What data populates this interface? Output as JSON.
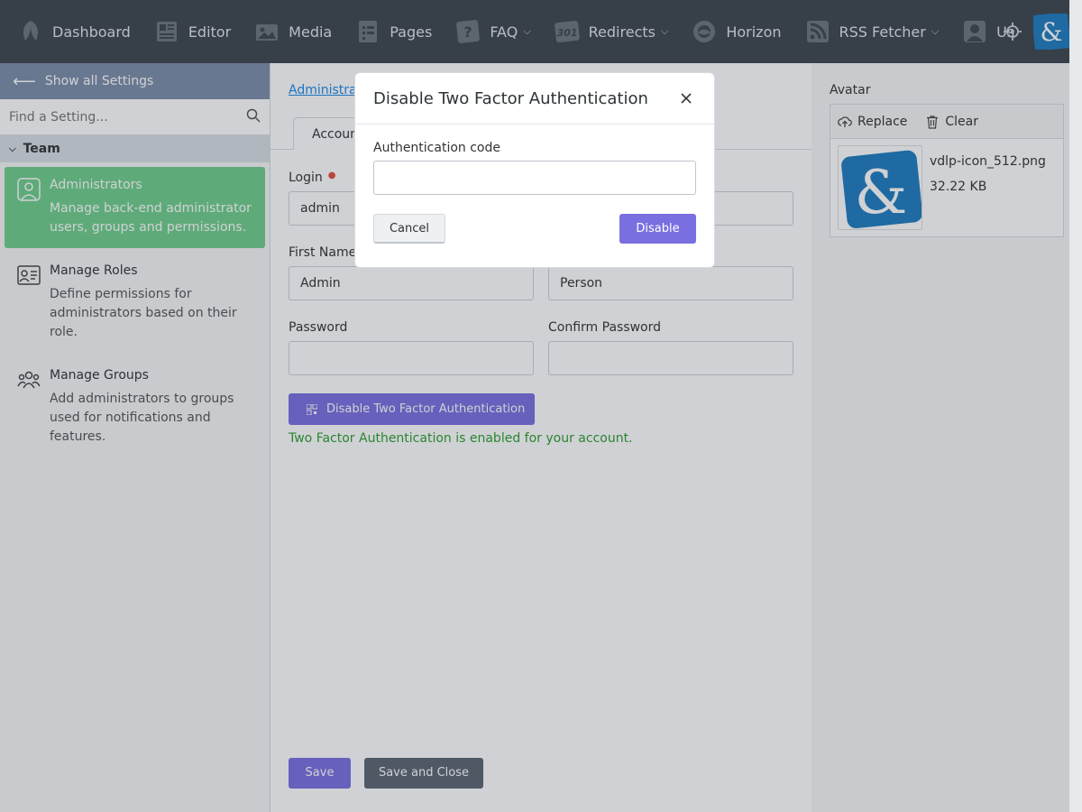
{
  "nav": {
    "items": [
      {
        "label": "Dashboard",
        "icon": "leaf-icon",
        "dropdown": false
      },
      {
        "label": "Editor",
        "icon": "editor-icon",
        "dropdown": false
      },
      {
        "label": "Media",
        "icon": "media-icon",
        "dropdown": false
      },
      {
        "label": "Pages",
        "icon": "pages-icon",
        "dropdown": false
      },
      {
        "label": "FAQ",
        "icon": "question-icon",
        "dropdown": true
      },
      {
        "label": "Redirects",
        "icon": "redirect-301-icon",
        "dropdown": true
      },
      {
        "label": "Horizon",
        "icon": "horizon-icon",
        "dropdown": false
      },
      {
        "label": "RSS Fetcher",
        "icon": "rss-icon",
        "dropdown": true
      },
      {
        "label": "Us",
        "icon": "user-icon",
        "dropdown": false
      }
    ],
    "redirect_badge": "301",
    "question_badge": "?"
  },
  "sidebar": {
    "show_all": "Show all Settings",
    "search_placeholder": "Find a Setting...",
    "group": "Team",
    "items": [
      {
        "title": "Administrators",
        "desc": "Manage back-end administrator users, groups and permissions.",
        "active": true
      },
      {
        "title": "Manage Roles",
        "desc": "Define permissions for administrators based on their role.",
        "active": false
      },
      {
        "title": "Manage Groups",
        "desc": "Add administrators to groups used for notifications and features.",
        "active": false
      }
    ]
  },
  "main": {
    "breadcrumb": "Administrat",
    "tab": "Accoun",
    "login_label": "Login",
    "login_value": "admin",
    "first_name_label": "First Name",
    "first_name_value": "Admin",
    "last_name_value": "Person",
    "password_label": "Password",
    "confirm_password_label": "Confirm Password",
    "twofa_button": "Disable Two Factor Authentication",
    "twofa_status": "Two Factor Authentication is enabled for your account.",
    "save": "Save",
    "save_close": "Save and Close"
  },
  "avatar": {
    "label": "Avatar",
    "replace": "Replace",
    "clear": "Clear",
    "file_name": "vdlp-icon_512.png",
    "file_size": "32.22 KB"
  },
  "modal": {
    "title": "Disable Two Factor Authentication",
    "code_label": "Authentication code",
    "code_value": "",
    "cancel": "Cancel",
    "disable": "Disable"
  },
  "colors": {
    "topbar": "#3d444c",
    "primary": "#7a6fe0",
    "active_item": "#6fcf8b",
    "success_text": "#2e9e2e"
  }
}
